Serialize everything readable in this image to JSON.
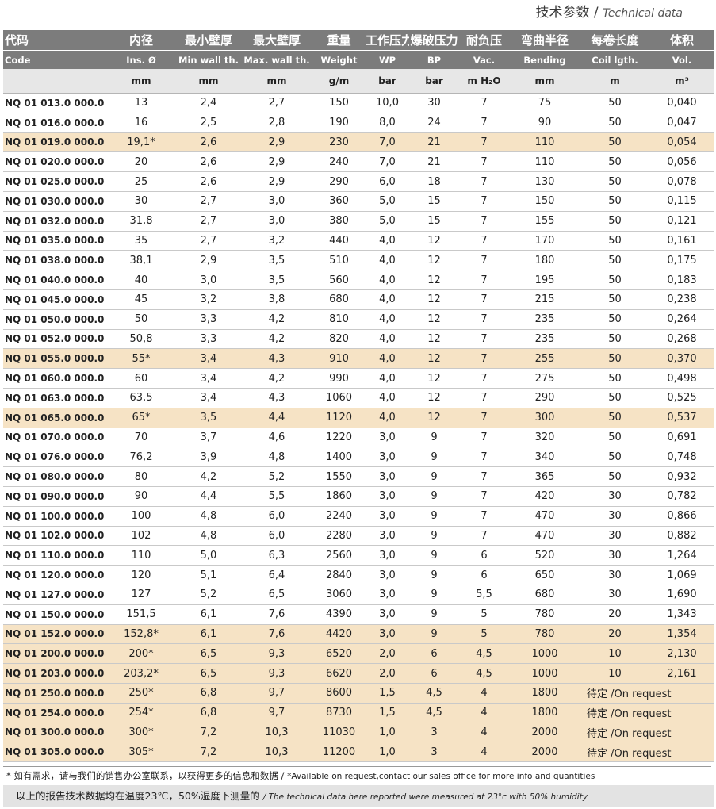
{
  "title": {
    "zh": "技术参数",
    "sep": " / ",
    "en": "Technical data"
  },
  "headers": {
    "zh": [
      "代码",
      "内径",
      "最小壁厚",
      "最大壁厚",
      "重量",
      "工作压力",
      "爆破压力",
      "耐负压",
      "弯曲半径",
      "每卷长度",
      "体积"
    ],
    "en": [
      "Code",
      "Ins. Ø",
      "Min wall th.",
      "Max. wall th.",
      "Weight",
      "WP",
      "BP",
      "Vac.",
      "Bending",
      "Coil lgth.",
      "Vol."
    ],
    "units": [
      "",
      "mm",
      "mm",
      "mm",
      "g/m",
      "bar",
      "bar",
      "m H₂O",
      "mm",
      "m",
      "m³"
    ]
  },
  "rows": [
    {
      "code": "NQ 01 013.0 000.0",
      "id": "13",
      "min": "2,4",
      "max": "2,7",
      "w": "150",
      "wp": "10,0",
      "bp": "30",
      "vac": "7",
      "bend": "75",
      "coil": "50",
      "vol": "0,040",
      "hl": false
    },
    {
      "code": "NQ 01 016.0 000.0",
      "id": "16",
      "min": "2,5",
      "max": "2,8",
      "w": "190",
      "wp": "8,0",
      "bp": "24",
      "vac": "7",
      "bend": "90",
      "coil": "50",
      "vol": "0,047",
      "hl": false
    },
    {
      "code": "NQ 01 019.0 000.0",
      "id": "19,1*",
      "min": "2,6",
      "max": "2,9",
      "w": "230",
      "wp": "7,0",
      "bp": "21",
      "vac": "7",
      "bend": "110",
      "coil": "50",
      "vol": "0,054",
      "hl": true
    },
    {
      "code": "NQ 01 020.0 000.0",
      "id": "20",
      "min": "2,6",
      "max": "2,9",
      "w": "240",
      "wp": "7,0",
      "bp": "21",
      "vac": "7",
      "bend": "110",
      "coil": "50",
      "vol": "0,056",
      "hl": false
    },
    {
      "code": "NQ 01 025.0 000.0",
      "id": "25",
      "min": "2,6",
      "max": "2,9",
      "w": "290",
      "wp": "6,0",
      "bp": "18",
      "vac": "7",
      "bend": "130",
      "coil": "50",
      "vol": "0,078",
      "hl": false
    },
    {
      "code": "NQ 01 030.0 000.0",
      "id": "30",
      "min": "2,7",
      "max": "3,0",
      "w": "360",
      "wp": "5,0",
      "bp": "15",
      "vac": "7",
      "bend": "150",
      "coil": "50",
      "vol": "0,115",
      "hl": false
    },
    {
      "code": "NQ 01 032.0 000.0",
      "id": "31,8",
      "min": "2,7",
      "max": "3,0",
      "w": "380",
      "wp": "5,0",
      "bp": "15",
      "vac": "7",
      "bend": "155",
      "coil": "50",
      "vol": "0,121",
      "hl": false
    },
    {
      "code": "NQ 01 035.0 000.0",
      "id": "35",
      "min": "2,7",
      "max": "3,2",
      "w": "440",
      "wp": "4,0",
      "bp": "12",
      "vac": "7",
      "bend": "170",
      "coil": "50",
      "vol": "0,161",
      "hl": false
    },
    {
      "code": "NQ 01 038.0 000.0",
      "id": "38,1",
      "min": "2,9",
      "max": "3,5",
      "w": "510",
      "wp": "4,0",
      "bp": "12",
      "vac": "7",
      "bend": "180",
      "coil": "50",
      "vol": "0,175",
      "hl": false
    },
    {
      "code": "NQ 01 040.0 000.0",
      "id": "40",
      "min": "3,0",
      "max": "3,5",
      "w": "560",
      "wp": "4,0",
      "bp": "12",
      "vac": "7",
      "bend": "195",
      "coil": "50",
      "vol": "0,183",
      "hl": false
    },
    {
      "code": "NQ 01 045.0 000.0",
      "id": "45",
      "min": "3,2",
      "max": "3,8",
      "w": "680",
      "wp": "4,0",
      "bp": "12",
      "vac": "7",
      "bend": "215",
      "coil": "50",
      "vol": "0,238",
      "hl": false
    },
    {
      "code": "NQ 01 050.0 000.0",
      "id": "50",
      "min": "3,3",
      "max": "4,2",
      "w": "810",
      "wp": "4,0",
      "bp": "12",
      "vac": "7",
      "bend": "235",
      "coil": "50",
      "vol": "0,264",
      "hl": false
    },
    {
      "code": "NQ 01 052.0 000.0",
      "id": "50,8",
      "min": "3,3",
      "max": "4,2",
      "w": "820",
      "wp": "4,0",
      "bp": "12",
      "vac": "7",
      "bend": "235",
      "coil": "50",
      "vol": "0,268",
      "hl": false
    },
    {
      "code": "NQ 01 055.0 000.0",
      "id": "55*",
      "min": "3,4",
      "max": "4,3",
      "w": "910",
      "wp": "4,0",
      "bp": "12",
      "vac": "7",
      "bend": "255",
      "coil": "50",
      "vol": "0,370",
      "hl": true
    },
    {
      "code": "NQ 01 060.0 000.0",
      "id": "60",
      "min": "3,4",
      "max": "4,2",
      "w": "990",
      "wp": "4,0",
      "bp": "12",
      "vac": "7",
      "bend": "275",
      "coil": "50",
      "vol": "0,498",
      "hl": false
    },
    {
      "code": "NQ 01 063.0 000.0",
      "id": "63,5",
      "min": "3,4",
      "max": "4,3",
      "w": "1060",
      "wp": "4,0",
      "bp": "12",
      "vac": "7",
      "bend": "290",
      "coil": "50",
      "vol": "0,525",
      "hl": false
    },
    {
      "code": "NQ 01 065.0 000.0",
      "id": "65*",
      "min": "3,5",
      "max": "4,4",
      "w": "1120",
      "wp": "4,0",
      "bp": "12",
      "vac": "7",
      "bend": "300",
      "coil": "50",
      "vol": "0,537",
      "hl": true
    },
    {
      "code": "NQ 01 070.0 000.0",
      "id": "70",
      "min": "3,7",
      "max": "4,6",
      "w": "1220",
      "wp": "3,0",
      "bp": "9",
      "vac": "7",
      "bend": "320",
      "coil": "50",
      "vol": "0,691",
      "hl": false
    },
    {
      "code": "NQ 01 076.0 000.0",
      "id": "76,2",
      "min": "3,9",
      "max": "4,8",
      "w": "1400",
      "wp": "3,0",
      "bp": "9",
      "vac": "7",
      "bend": "340",
      "coil": "50",
      "vol": "0,748",
      "hl": false
    },
    {
      "code": "NQ 01 080.0 000.0",
      "id": "80",
      "min": "4,2",
      "max": "5,2",
      "w": "1550",
      "wp": "3,0",
      "bp": "9",
      "vac": "7",
      "bend": "365",
      "coil": "50",
      "vol": "0,932",
      "hl": false
    },
    {
      "code": "NQ 01 090.0 000.0",
      "id": "90",
      "min": "4,4",
      "max": "5,5",
      "w": "1860",
      "wp": "3,0",
      "bp": "9",
      "vac": "7",
      "bend": "420",
      "coil": "30",
      "vol": "0,782",
      "hl": false
    },
    {
      "code": "NQ 01 100.0 000.0",
      "id": "100",
      "min": "4,8",
      "max": "6,0",
      "w": "2240",
      "wp": "3,0",
      "bp": "9",
      "vac": "7",
      "bend": "470",
      "coil": "30",
      "vol": "0,866",
      "hl": false
    },
    {
      "code": "NQ 01 102.0 000.0",
      "id": "102",
      "min": "4,8",
      "max": "6,0",
      "w": "2280",
      "wp": "3,0",
      "bp": "9",
      "vac": "7",
      "bend": "470",
      "coil": "30",
      "vol": "0,882",
      "hl": false
    },
    {
      "code": "NQ 01 110.0 000.0",
      "id": "110",
      "min": "5,0",
      "max": "6,3",
      "w": "2560",
      "wp": "3,0",
      "bp": "9",
      "vac": "6",
      "bend": "520",
      "coil": "30",
      "vol": "1,264",
      "hl": false
    },
    {
      "code": "NQ 01 120.0 000.0",
      "id": "120",
      "min": "5,1",
      "max": "6,4",
      "w": "2840",
      "wp": "3,0",
      "bp": "9",
      "vac": "6",
      "bend": "650",
      "coil": "30",
      "vol": "1,069",
      "hl": false
    },
    {
      "code": "NQ 01 127.0 000.0",
      "id": "127",
      "min": "5,2",
      "max": "6,5",
      "w": "3060",
      "wp": "3,0",
      "bp": "9",
      "vac": "5,5",
      "bend": "680",
      "coil": "30",
      "vol": "1,690",
      "hl": false
    },
    {
      "code": "NQ 01 150.0 000.0",
      "id": "151,5",
      "min": "6,1",
      "max": "7,6",
      "w": "4390",
      "wp": "3,0",
      "bp": "9",
      "vac": "5",
      "bend": "780",
      "coil": "20",
      "vol": "1,343",
      "hl": false
    },
    {
      "code": "NQ 01 152.0 000.0",
      "id": "152,8*",
      "min": "6,1",
      "max": "7,6",
      "w": "4420",
      "wp": "3,0",
      "bp": "9",
      "vac": "5",
      "bend": "780",
      "coil": "20",
      "vol": "1,354",
      "hl": true
    },
    {
      "code": "NQ 01 200.0 000.0",
      "id": "200*",
      "min": "6,5",
      "max": "9,3",
      "w": "6520",
      "wp": "2,0",
      "bp": "6",
      "vac": "4,5",
      "bend": "1000",
      "coil": "10",
      "vol": "2,130",
      "hl": true
    },
    {
      "code": "NQ 01 203.0 000.0",
      "id": "203,2*",
      "min": "6,5",
      "max": "9,3",
      "w": "6620",
      "wp": "2,0",
      "bp": "6",
      "vac": "4,5",
      "bend": "1000",
      "coil": "10",
      "vol": "2,161",
      "hl": true
    },
    {
      "code": "NQ 01 250.0 000.0",
      "id": "250*",
      "min": "6,8",
      "max": "9,7",
      "w": "8600",
      "wp": "1,5",
      "bp": "4,5",
      "vac": "4",
      "bend": "1800",
      "req": "待定 /On request",
      "hl": true
    },
    {
      "code": "NQ 01 254.0 000.0",
      "id": "254*",
      "min": "6,8",
      "max": "9,7",
      "w": "8730",
      "wp": "1,5",
      "bp": "4,5",
      "vac": "4",
      "bend": "1800",
      "req": "待定 /On request",
      "hl": true
    },
    {
      "code": "NQ 01 300.0 000.0",
      "id": "300*",
      "min": "7,2",
      "max": "10,3",
      "w": "11030",
      "wp": "1,0",
      "bp": "3",
      "vac": "4",
      "bend": "2000",
      "req": "待定 /On request",
      "hl": true
    },
    {
      "code": "NQ 01 305.0 000.0",
      "id": "305*",
      "min": "7,2",
      "max": "10,3",
      "w": "11200",
      "wp": "1,0",
      "bp": "3",
      "vac": "4",
      "bend": "2000",
      "req": "待定 /On request",
      "hl": true
    }
  ],
  "footnote": {
    "zh": "* 如有需求，请与我们的销售办公室联系，以获得更多的信息和数据 / ",
    "en": "*Available on request,contact our sales office for more info and quantities"
  },
  "bottom_note": {
    "zh": "以上的报告技术数据均在温度23℃，50%湿度下测量的 ",
    "en": "/ The technical data here reported were measured at 23°c with 50% humidity"
  },
  "colors": {
    "header_bg": "#7c7c7c",
    "unit_row_bg": "#e7e7e7",
    "highlight_row": "#f6e3c5",
    "bottom_bar": "#e3e3e3"
  }
}
